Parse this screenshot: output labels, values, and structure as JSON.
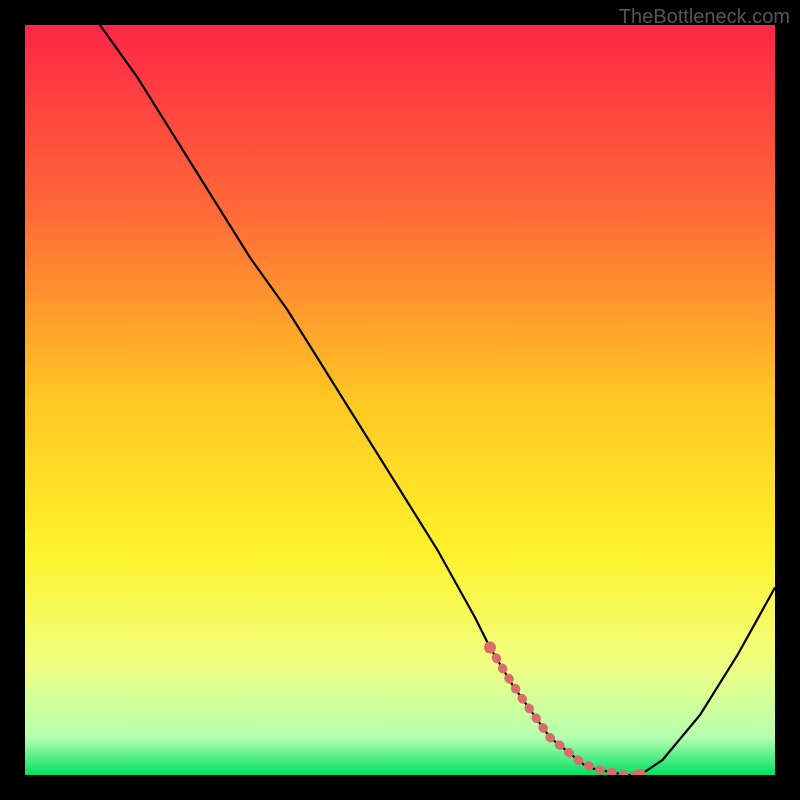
{
  "watermark": "TheBottleneck.com",
  "chart_data": {
    "type": "line",
    "title": "",
    "xlabel": "",
    "ylabel": "",
    "xlim": [
      0,
      100
    ],
    "ylim": [
      0,
      100
    ],
    "grid": false,
    "background": "rainbow-gradient",
    "series": [
      {
        "name": "curve",
        "x": [
          10,
          15,
          20,
          25,
          30,
          35,
          40,
          45,
          50,
          55,
          60,
          62,
          65,
          70,
          75,
          80,
          82,
          85,
          90,
          95,
          100
        ],
        "y": [
          100,
          93,
          85,
          77,
          69,
          62,
          54,
          46,
          38,
          30,
          21,
          17,
          12,
          5,
          1,
          0,
          0,
          2,
          8,
          16,
          25
        ]
      }
    ],
    "highlighted_region": {
      "x_start": 62,
      "x_end": 82,
      "marker_color": "#d96d6d"
    },
    "gradient_stops": [
      {
        "offset": 0,
        "color": "#ff2646"
      },
      {
        "offset": 25,
        "color": "#ff6a38"
      },
      {
        "offset": 50,
        "color": "#ffc724"
      },
      {
        "offset": 70,
        "color": "#fff22a"
      },
      {
        "offset": 85,
        "color": "#f1ff80"
      },
      {
        "offset": 95,
        "color": "#b6ffb0"
      },
      {
        "offset": 100,
        "color": "#00e060"
      }
    ]
  }
}
